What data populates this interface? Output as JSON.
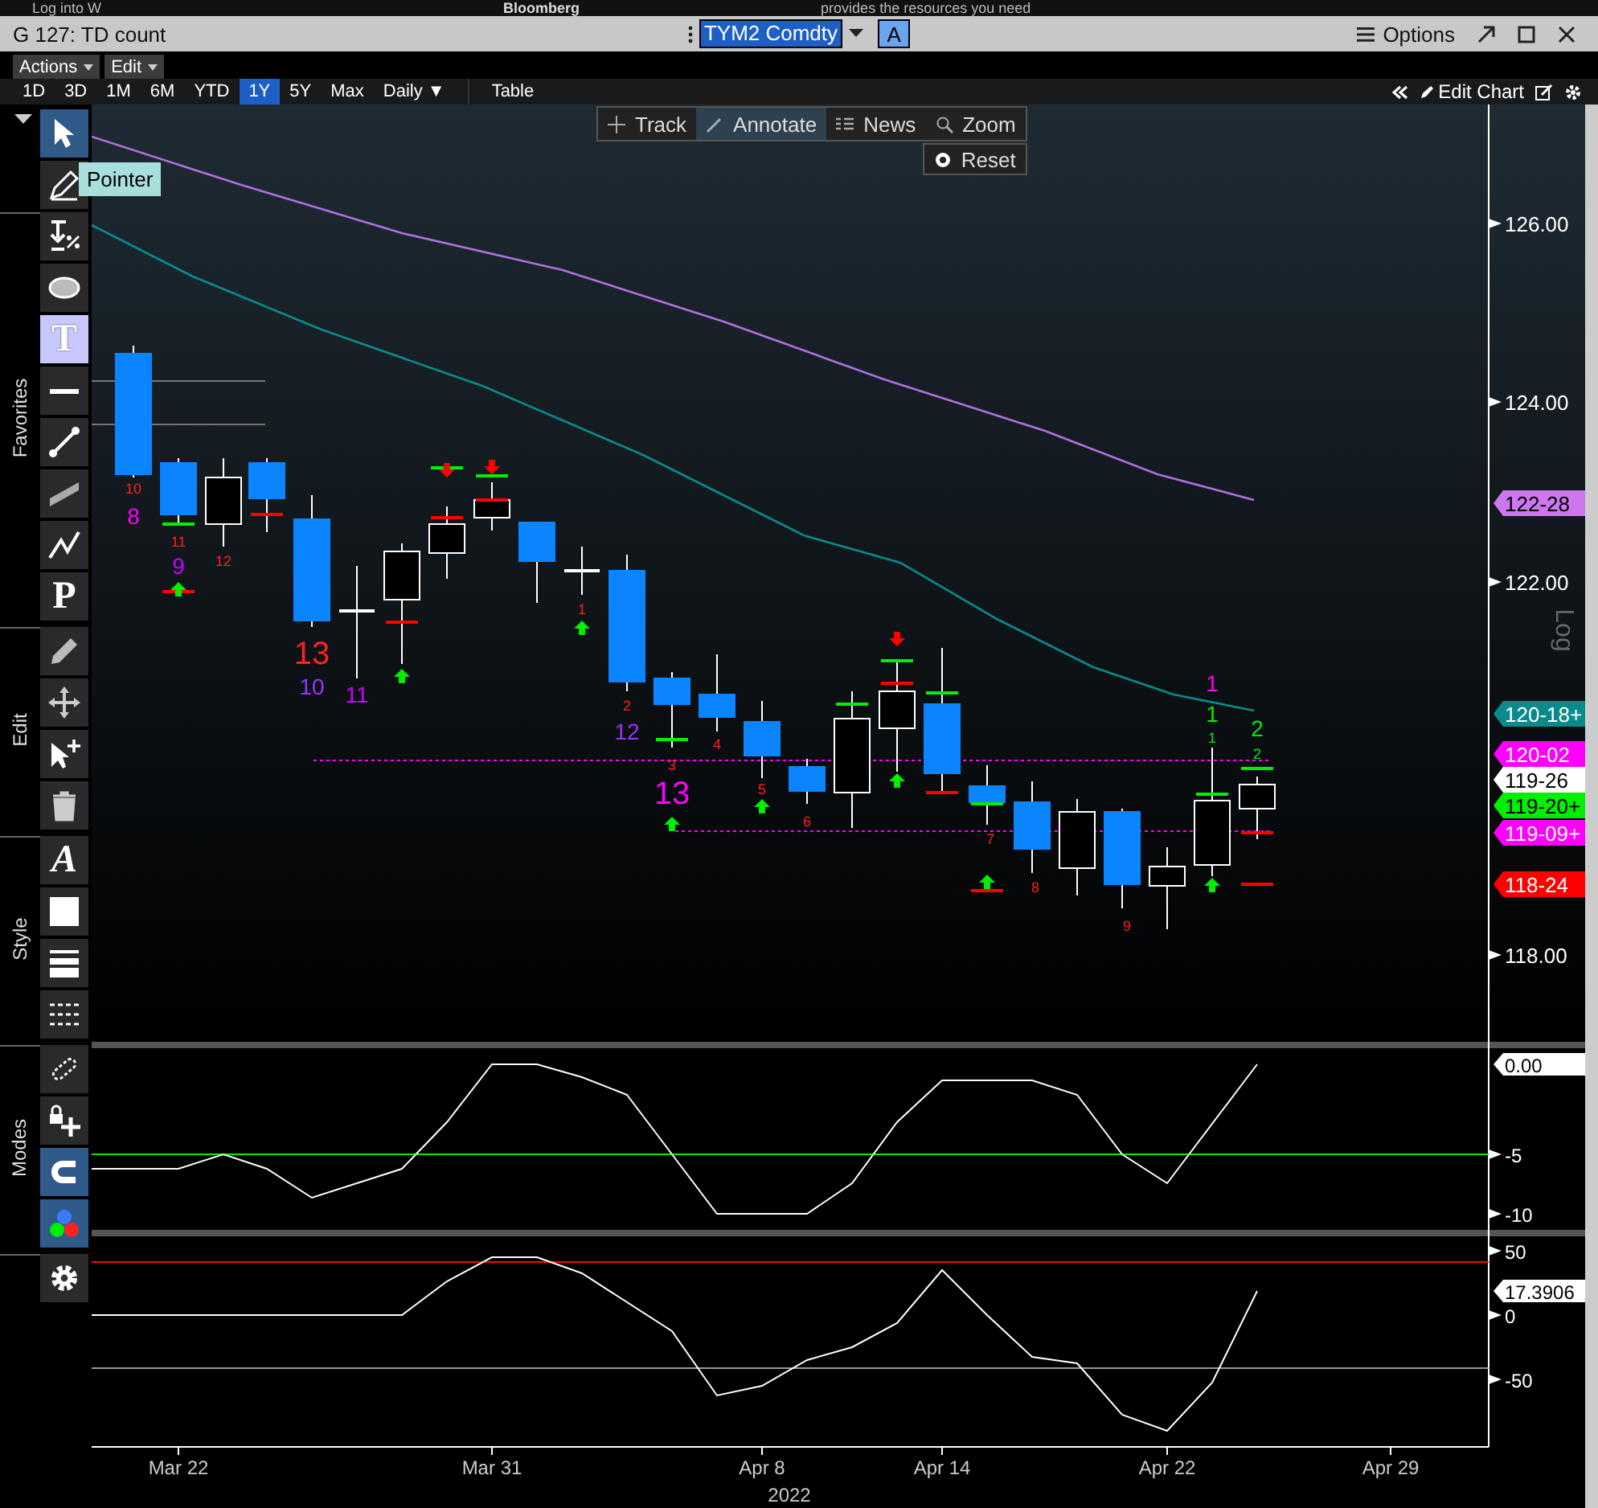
{
  "background_window": {
    "texts": [
      "Log into W",
      "Bloomberg",
      "provides the resources you need"
    ]
  },
  "window": {
    "title": "G 127: TD count",
    "security": "TYM2 Comdty",
    "mode_button": "A",
    "options": "Options"
  },
  "menus": [
    "Actions",
    "Edit"
  ],
  "periods": [
    {
      "label": "1D",
      "selected": false
    },
    {
      "label": "3D",
      "selected": false
    },
    {
      "label": "1M",
      "selected": false
    },
    {
      "label": "6M",
      "selected": false
    },
    {
      "label": "YTD",
      "selected": false
    },
    {
      "label": "1Y",
      "selected": true
    },
    {
      "label": "5Y",
      "selected": false
    },
    {
      "label": "Max",
      "selected": false
    }
  ],
  "frequency": "Daily ▼",
  "table_button": "Table",
  "edit_chart": "Edit Chart",
  "chart_tools": [
    {
      "label": "Track",
      "kind": "track",
      "selected": false
    },
    {
      "label": "Annotate",
      "kind": "annotate",
      "selected": true
    },
    {
      "label": "News",
      "kind": "news",
      "selected": false
    },
    {
      "label": "Zoom",
      "kind": "zoom",
      "selected": false
    }
  ],
  "reset": "Reset",
  "tooltip": "Pointer",
  "toolbar": [
    {
      "tools": [
        {
          "kind": "pointer",
          "selected": true
        },
        {
          "kind": "pen",
          "selected": false
        }
      ]
    },
    {
      "label": "Favorites",
      "tools": [
        {
          "kind": "fib",
          "selected": false
        },
        {
          "kind": "ellipse",
          "selected": false
        },
        {
          "kind": "glyph",
          "glyph": "T",
          "selected": true
        },
        {
          "kind": "line",
          "selected": false
        },
        {
          "kind": "segment",
          "selected": false
        },
        {
          "kind": "channel",
          "selected": false
        },
        {
          "kind": "trend",
          "selected": false
        },
        {
          "kind": "glyph",
          "glyph": "P",
          "selected": false
        }
      ]
    },
    {
      "label": "Edit",
      "tools": [
        {
          "kind": "pencil",
          "selected": false
        },
        {
          "kind": "move",
          "selected": false
        },
        {
          "kind": "add-pointer",
          "selected": false
        },
        {
          "kind": "trash",
          "selected": false
        }
      ]
    },
    {
      "label": "Style",
      "tools": [
        {
          "kind": "glyph",
          "glyph": "A",
          "selected": false
        },
        {
          "kind": "fill",
          "selected": false
        },
        {
          "kind": "line-weight",
          "selected": false
        },
        {
          "kind": "line-style",
          "selected": false
        }
      ]
    },
    {
      "label": "Modes",
      "tools": [
        {
          "kind": "chain",
          "selected": false
        },
        {
          "kind": "lock-add",
          "selected": false
        },
        {
          "kind": "magnet",
          "selected": true
        },
        {
          "kind": "colors",
          "selected": true
        }
      ]
    },
    {
      "tools": [
        {
          "kind": "gear",
          "selected": false
        }
      ]
    }
  ],
  "price_axis": {
    "ticks": [
      "126.00",
      "124.00",
      "122.00",
      "118.00"
    ],
    "scale_label": "Log",
    "tags": [
      {
        "text": "122-28",
        "color": "#cc77ee"
      },
      {
        "text": "120-18+",
        "color": "#0a8a8a"
      },
      {
        "text": "120-02",
        "color": "#ff00ff"
      },
      {
        "text": "119-26",
        "color": "#ffffff"
      },
      {
        "text": "119-20+",
        "color": "#00ee00"
      },
      {
        "text": "119-09+",
        "color": "#ff00ff"
      },
      {
        "text": "118-24",
        "color": "#ff0000"
      }
    ]
  },
  "td_labels": [
    {
      "text": "10",
      "kind": "small",
      "color": "#ff2020"
    },
    {
      "text": "8",
      "kind": "medium",
      "color": "#ff00ff"
    },
    {
      "text": "11",
      "kind": "small",
      "color": "#ff2020"
    },
    {
      "text": "9",
      "kind": "medium",
      "color": "#cc00ff"
    },
    {
      "text": "12",
      "kind": "small",
      "color": "#ff2020"
    },
    {
      "text": "13",
      "kind": "large",
      "color": "#ff2020"
    },
    {
      "text": "10",
      "kind": "medium",
      "color": "#9933ff"
    },
    {
      "text": "11",
      "kind": "medium",
      "color": "#cc00ff"
    },
    {
      "text": "1",
      "kind": "small",
      "color": "#ff2020"
    },
    {
      "text": "2",
      "kind": "small",
      "color": "#ff2020"
    },
    {
      "text": "12",
      "kind": "medium",
      "color": "#9933ff"
    },
    {
      "text": "3",
      "kind": "small",
      "color": "#ff2020"
    },
    {
      "text": "13",
      "kind": "large",
      "color": "#ff00ff"
    },
    {
      "text": "4",
      "kind": "small",
      "color": "#ff2020"
    },
    {
      "text": "5",
      "kind": "small",
      "color": "#ff2020"
    },
    {
      "text": "6",
      "kind": "small",
      "color": "#ff2020"
    },
    {
      "text": "7",
      "kind": "small",
      "color": "#ff2020"
    },
    {
      "text": "8",
      "kind": "small",
      "color": "#ff2020"
    },
    {
      "text": "9",
      "kind": "small",
      "color": "#ff2020"
    },
    {
      "text": "1",
      "kind": "medium",
      "color": "#ff00ff"
    },
    {
      "text": "1",
      "kind": "medium",
      "color": "#00ee00"
    },
    {
      "text": "1",
      "kind": "small",
      "color": "#00ee00"
    },
    {
      "text": "2",
      "kind": "medium",
      "color": "#00ee00"
    },
    {
      "text": "2",
      "kind": "small",
      "color": "#00ee00"
    }
  ],
  "oscillator_1": {
    "tag": "0.00",
    "ticks": [
      "-5",
      "-10"
    ]
  },
  "oscillator_2": {
    "tag": "17.3906",
    "ticks": [
      "50",
      "0",
      "-50"
    ]
  },
  "x_axis": {
    "labels": [
      "Mar 22",
      "Mar 31",
      "Apr 8",
      "Apr 14",
      "Apr 22",
      "Apr 29"
    ],
    "year": "2022"
  }
}
